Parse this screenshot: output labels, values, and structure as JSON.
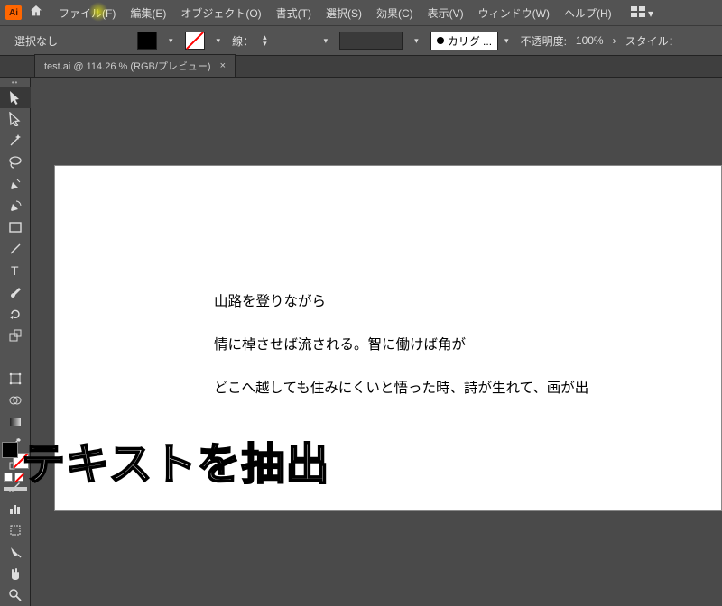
{
  "menubar": {
    "app": "Ai",
    "items": [
      "ファイル(F)",
      "編集(E)",
      "オブジェクト(O)",
      "書式(T)",
      "選択(S)",
      "効果(C)",
      "表示(V)",
      "ウィンドウ(W)",
      "ヘルプ(H)"
    ]
  },
  "options": {
    "selection": "選択なし",
    "stroke_label": "線：",
    "brush": "カリグ ...",
    "opacity_label": "不透明度:",
    "opacity_value": "100%",
    "style_label": "スタイル："
  },
  "tab": {
    "title": "test.ai @ 114.26 % (RGB/プレビュー)",
    "close": "×"
  },
  "canvas": {
    "lines": [
      "山路を登りながら",
      "情に棹させば流される。智に働けば角が",
      "どこへ越しても住みにくいと悟った時、詩が生れて、画が出"
    ]
  },
  "caption": "テキストを抽出"
}
